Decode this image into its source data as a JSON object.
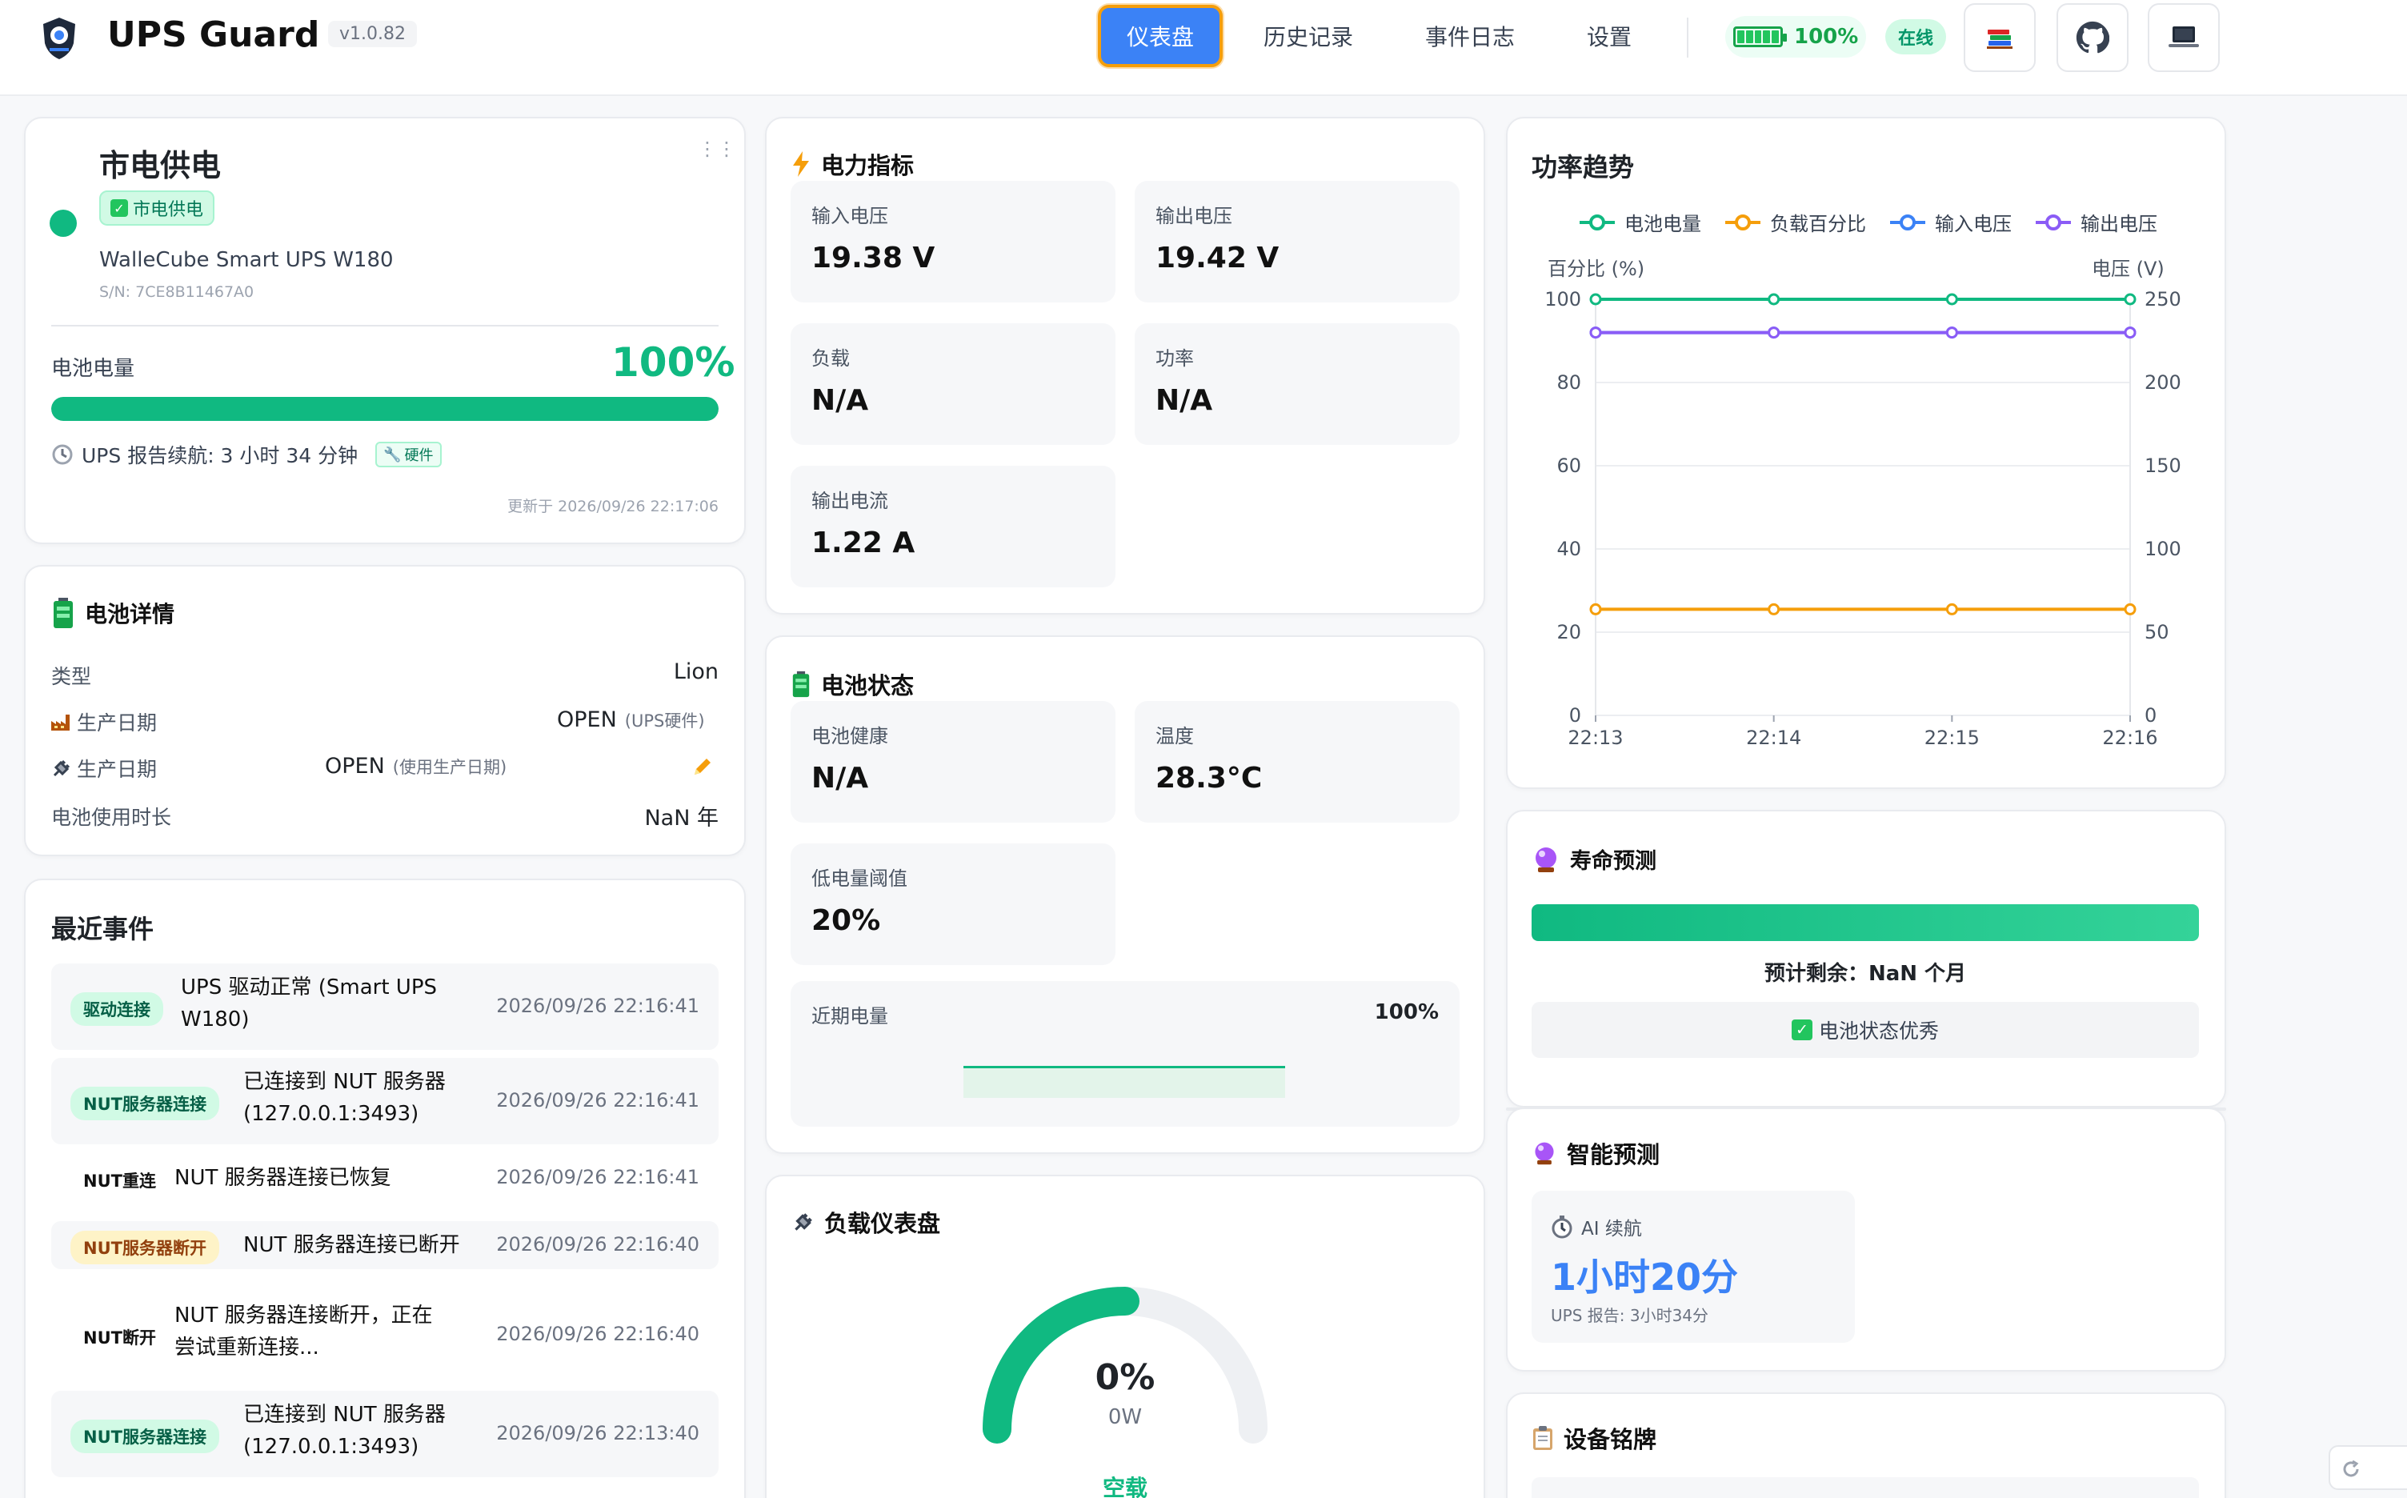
{
  "header": {
    "app_title": "UPS Guard",
    "version": "v1.0.82",
    "nav": [
      {
        "label": "仪表盘",
        "active": true
      },
      {
        "label": "历史记录",
        "active": false
      },
      {
        "label": "事件日志",
        "active": false
      },
      {
        "label": "设置",
        "active": false
      }
    ],
    "battery_percent": "100%",
    "online_status": "在线",
    "icons": [
      "books-icon",
      "github-icon",
      "laptop-icon"
    ]
  },
  "power_card": {
    "title": "市电供电",
    "tag": "市电供电",
    "model": "WalleCube Smart UPS W180",
    "serial": "S/N: 7CE8B11467A0",
    "battery_label": "电池电量",
    "battery_value": "100%",
    "battery_fraction": 1.0,
    "runtime_text": "UPS 报告续航: 3 小时 34 分钟",
    "hw_tag": "硬件",
    "updated": "更新于 2026/09/26 22:17:06"
  },
  "battery_details": {
    "title": "电池详情",
    "rows": [
      {
        "label": "类型",
        "value": "Lion",
        "note": ""
      },
      {
        "label": "生产日期",
        "value": "OPEN",
        "note": "(UPS硬件)"
      },
      {
        "label": "生产日期",
        "value": "OPEN",
        "note": "(使用生产日期)"
      },
      {
        "label": "电池使用时长",
        "value": "NaN 年",
        "note": ""
      }
    ]
  },
  "events": {
    "title": "最近事件",
    "items": [
      {
        "badge": "驱动连接",
        "style": "green",
        "text": "UPS 驱动正常 (Smart UPS W180)",
        "time": "2026/09/26 22:16:41"
      },
      {
        "badge": "NUT服务器连接",
        "style": "green",
        "text": "已连接到 NUT 服务器 (127.0.0.1:3493)",
        "time": "2026/09/26 22:16:41"
      },
      {
        "badge": "NUT重连",
        "style": "plain",
        "text": "NUT 服务器连接已恢复",
        "time": "2026/09/26 22:16:41"
      },
      {
        "badge": "NUT服务器断开",
        "style": "yellow",
        "text": "NUT 服务器连接已断开",
        "time": "2026/09/26 22:16:40"
      },
      {
        "badge": "NUT断开",
        "style": "plain",
        "text": "NUT 服务器连接断开，正在尝试重新连接...",
        "time": "2026/09/26 22:16:40"
      },
      {
        "badge": "NUT服务器连接",
        "style": "green",
        "text": "已连接到 NUT 服务器 (127.0.0.1:3493)",
        "time": "2026/09/26 22:13:40"
      }
    ]
  },
  "power_metrics": {
    "title": "电力指标",
    "tiles": [
      {
        "label": "输入电压",
        "value": "19.38 V"
      },
      {
        "label": "输出电压",
        "value": "19.42 V"
      },
      {
        "label": "负载",
        "value": "N/A"
      },
      {
        "label": "功率",
        "value": "N/A"
      },
      {
        "label": "输出电流",
        "value": "1.22 A"
      }
    ]
  },
  "battery_status": {
    "title": "电池状态",
    "tiles": [
      {
        "label": "电池健康",
        "value": "N/A"
      },
      {
        "label": "温度",
        "value": "28.3°C"
      },
      {
        "label": "低电量阈值",
        "value": "20%"
      }
    ],
    "recent_label": "近期电量",
    "recent_value": "100%",
    "recent_fraction": 1.0
  },
  "load_gauge": {
    "title": "负载仪表盘",
    "percent": "0%",
    "watts": "0W",
    "state": "空载",
    "fraction": 0.0
  },
  "trend": {
    "title": "功率趋势",
    "left_axis_label": "百分比 (%)",
    "right_axis_label": "电压 (V)"
  },
  "chart_data": {
    "type": "line",
    "title": "功率趋势",
    "x": [
      "22:13",
      "22:14",
      "22:15",
      "22:16"
    ],
    "y_left": {
      "label": "百分比 (%)",
      "range": [
        0,
        100
      ],
      "ticks": [
        0,
        20,
        40,
        60,
        80,
        100
      ]
    },
    "y_right": {
      "label": "电压 (V)",
      "range": [
        0,
        250
      ],
      "ticks": [
        0,
        50,
        100,
        150,
        200,
        250
      ]
    },
    "legend_position": "top",
    "grid": true,
    "series": [
      {
        "name": "电池电量",
        "axis": "left",
        "color": "#10b981",
        "values": [
          100,
          100,
          100,
          100
        ]
      },
      {
        "name": "负载百分比",
        "axis": "left",
        "color": "#f59e0b",
        "values": [
          25.5,
          25.5,
          25.5,
          25.5
        ]
      },
      {
        "name": "输入电压",
        "axis": "right",
        "color": "#3b82f6",
        "values": [
          230,
          230,
          230,
          230
        ]
      },
      {
        "name": "输出电压",
        "axis": "right",
        "color": "#8b5cf6",
        "values": [
          230,
          230,
          230,
          230
        ]
      }
    ]
  },
  "lifespan": {
    "title": "寿命预测",
    "remaining": "预计剩余：NaN 个月",
    "status": "电池状态优秀",
    "fraction": 1.0
  },
  "smart_prediction": {
    "title": "智能预测",
    "ai_label": "AI 续航",
    "ai_value": "1小时20分",
    "ups_report": "UPS 报告: 3小时34分"
  },
  "nameplate": {
    "title": "设备铭牌"
  },
  "colors": {
    "accent": "#3b82f6",
    "success": "#10b981",
    "warning": "#f59e0b",
    "purple": "#8b5cf6"
  }
}
